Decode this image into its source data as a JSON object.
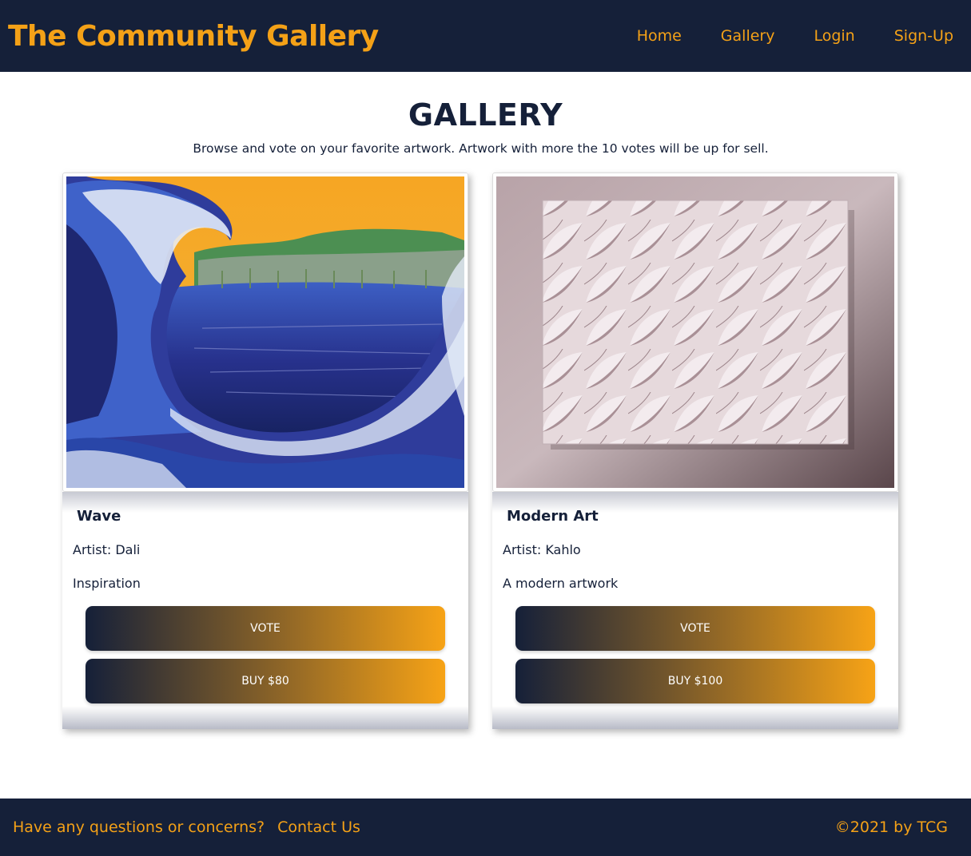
{
  "header": {
    "brand": "The Community Gallery",
    "nav": [
      "Home",
      "Gallery",
      "Login",
      "Sign-Up"
    ]
  },
  "page": {
    "title": "GALLERY",
    "subtitle": "Browse and vote on your favorite artwork. Artwork with more the 10 votes will be up for sell."
  },
  "artworks": [
    {
      "title": "Wave",
      "artist": "Artist: Dali",
      "description": "Inspiration",
      "vote_label": "VOTE",
      "buy_label": "BUY $80"
    },
    {
      "title": "Modern Art",
      "artist": "Artist: Kahlo",
      "description": "A modern artwork",
      "vote_label": "VOTE",
      "buy_label": "BUY $100"
    }
  ],
  "footer": {
    "question": "Have any questions or concerns?",
    "contact": "Contact Us",
    "copyright": "©2021 by TCG"
  },
  "colors": {
    "navy": "#152039",
    "orange": "#f4a117",
    "white": "#ffffff"
  }
}
